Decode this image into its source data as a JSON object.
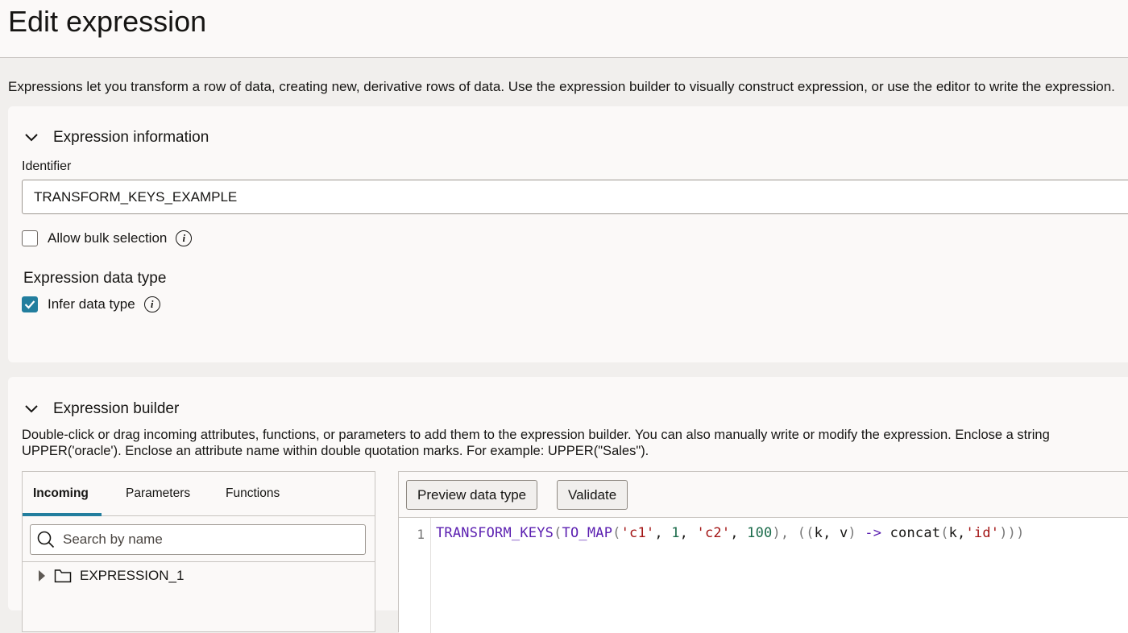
{
  "header": {
    "title": "Edit expression"
  },
  "intro_text": "Expressions let you transform a row of data, creating new, derivative rows of data. Use the expression builder to visually construct expression, or use the editor to write the expression.",
  "expression_information": {
    "heading": "Expression information",
    "identifier_label": "Identifier",
    "identifier_value": "TRANSFORM_KEYS_EXAMPLE",
    "allow_bulk_label": "Allow bulk selection",
    "allow_bulk_checked": false,
    "data_type_heading": "Expression data type",
    "infer_label": "Infer data type",
    "infer_checked": true
  },
  "expression_builder": {
    "heading": "Expression builder",
    "description_line1": "Double-click or drag incoming attributes, functions, or parameters to add them to the expression builder. You can also manually write or modify the expression. Enclose a string",
    "description_line2": "UPPER('oracle'). Enclose an attribute name within double quotation marks. For example: UPPER(\"Sales\").",
    "tabs": [
      "Incoming",
      "Parameters",
      "Functions"
    ],
    "active_tab": "Incoming",
    "search_placeholder": "Search by name",
    "tree_items": [
      "EXPRESSION_1"
    ],
    "buttons": {
      "preview": "Preview data type",
      "validate": "Validate"
    },
    "editor": {
      "line_number": "1",
      "tokens": [
        {
          "t": "TRANSFORM_KEYS",
          "k": "fn"
        },
        {
          "t": "(",
          "k": "punc"
        },
        {
          "t": "TO_MAP",
          "k": "fn"
        },
        {
          "t": "(",
          "k": "punc"
        },
        {
          "t": "'c1'",
          "k": "str"
        },
        {
          "t": ", ",
          "k": "id"
        },
        {
          "t": "1",
          "k": "num"
        },
        {
          "t": ", ",
          "k": "id"
        },
        {
          "t": "'c2'",
          "k": "str"
        },
        {
          "t": ", ",
          "k": "id"
        },
        {
          "t": "100",
          "k": "num"
        },
        {
          "t": "), ",
          "k": "punc"
        },
        {
          "t": "((",
          "k": "punc"
        },
        {
          "t": "k, v",
          "k": "id"
        },
        {
          "t": ") ",
          "k": "punc"
        },
        {
          "t": "->",
          "k": "op"
        },
        {
          "t": " concat",
          "k": "id"
        },
        {
          "t": "(",
          "k": "punc"
        },
        {
          "t": "k,",
          "k": "id"
        },
        {
          "t": "'id'",
          "k": "str"
        },
        {
          "t": ")))",
          "k": "punc"
        }
      ]
    }
  },
  "colors": {
    "accent": "#227e9e",
    "border": "#c8c4c0",
    "background": "#f1efed"
  }
}
